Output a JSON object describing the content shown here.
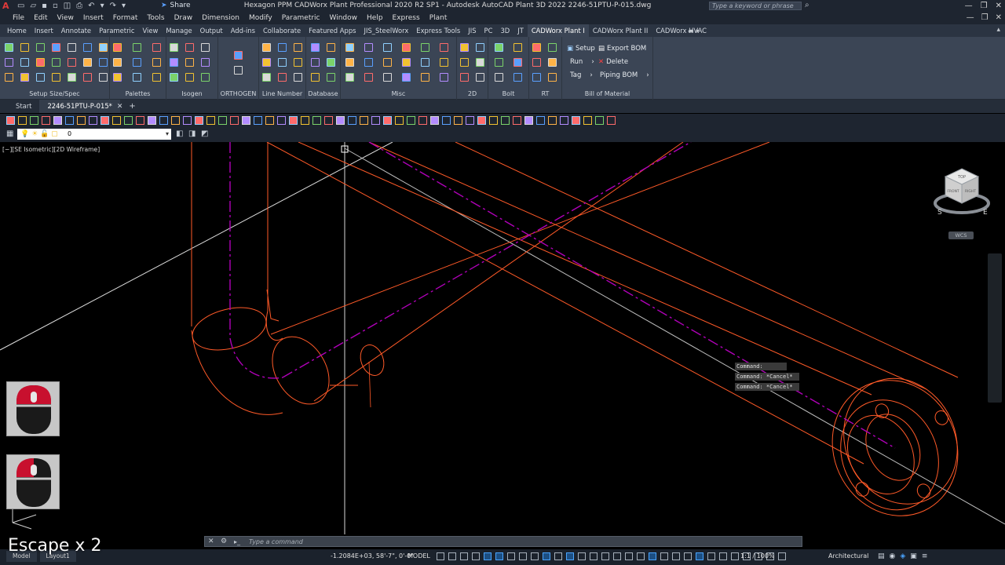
{
  "window": {
    "title": "Hexagon PPM CADWorx Plant Professional 2020 R2 SP1 - Autodesk AutoCAD Plant 3D 2022   2246-51PTU-P-015.dwg",
    "app_logo": "A",
    "share_label": "Share",
    "search_placeholder": "Type a keyword or phrase"
  },
  "menu": [
    "File",
    "Edit",
    "View",
    "Insert",
    "Format",
    "Tools",
    "Draw",
    "Dimension",
    "Modify",
    "Parametric",
    "Window",
    "Help",
    "Express",
    "Plant"
  ],
  "ribbon_tabs": [
    "Home",
    "Insert",
    "Annotate",
    "Parametric",
    "View",
    "Manage",
    "Output",
    "Add-ins",
    "Collaborate",
    "Featured Apps",
    "JIS_SteelWorx",
    "Express Tools",
    "JIS",
    "PC",
    "3D",
    "JT",
    "CADWorx Plant I",
    "CADWorx Plant II",
    "CADWorx HVAC"
  ],
  "active_ribbon_tab": "CADWorx Plant I",
  "panels": {
    "setup": "Setup Size/Spec",
    "palettes": "Palettes",
    "isogen": "Isogen",
    "orthogen": "ORTHOGEN",
    "line_number": "Line Number",
    "database": "Database",
    "misc": "Misc",
    "twod": "2D",
    "bolt": "Bolt",
    "rt": "RT",
    "bom": "Bill of Material"
  },
  "bom": {
    "setup": "Setup",
    "export": "Export BOM",
    "run": "Run",
    "delete": "Delete",
    "tag": "Tag",
    "piping": "Piping BOM"
  },
  "doc_tabs": {
    "start": "Start",
    "drawing": "2246-51PTU-P-015*"
  },
  "layer": {
    "current": "0"
  },
  "viewport": {
    "label": "[−][SE Isometric][2D Wireframe]",
    "wcs": "WCS",
    "cube_top": "TOP",
    "cube_front": "FRONT",
    "cube_right": "RIGHT",
    "compass_s": "S",
    "compass_e": "E"
  },
  "command_history": [
    "Command:",
    "Command: *Cancel*",
    "Command: *Cancel*"
  ],
  "command": {
    "placeholder": "Type a command"
  },
  "overlay": {
    "escape": "Escape  x 2"
  },
  "status": {
    "model_tab": "Model",
    "layout_tab": "Layout1",
    "coords": "-1.2084E+03, 58'-7\", 0'-0\"",
    "model": "MODEL",
    "scale": "1:1 / 100%",
    "units": "Architectural"
  },
  "colors": {
    "pipe": "#ff5a28",
    "centerline": "#b000b8",
    "crosshair": "#d8d8d8",
    "accent": "#4aa4ff"
  }
}
